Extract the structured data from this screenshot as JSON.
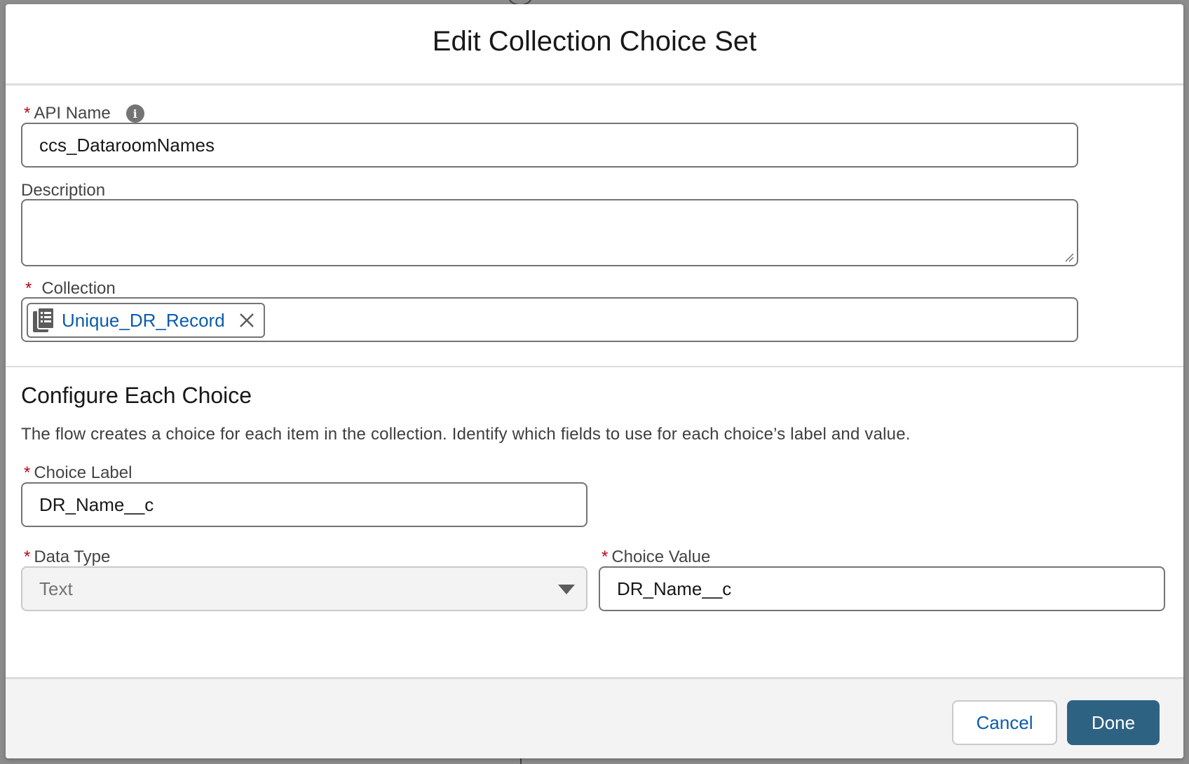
{
  "modal": {
    "title": "Edit Collection Choice Set"
  },
  "api_name": {
    "label": "API Name",
    "required_marker": "*",
    "value": "ccs_DataroomNames"
  },
  "description": {
    "label": "Description",
    "value": ""
  },
  "collection": {
    "label": "Collection",
    "required_marker": "*",
    "pill_label": "Unique_DR_Record"
  },
  "configure": {
    "title": "Configure Each Choice",
    "help_text": "The flow creates a choice for each item in the collection. Identify which fields to use for each choice’s label and value."
  },
  "choice_label": {
    "label": "Choice Label",
    "required_marker": "*",
    "value": "DR_Name__c"
  },
  "data_type": {
    "label": "Data Type",
    "required_marker": "*",
    "value": "Text"
  },
  "choice_value": {
    "label": "Choice Value",
    "required_marker": "*",
    "value": "DR_Name__c"
  },
  "footer": {
    "cancel_label": "Cancel",
    "done_label": "Done"
  },
  "colors": {
    "primary_button": "#2e6283",
    "link": "#0b5cab",
    "required": "#ba0517"
  }
}
